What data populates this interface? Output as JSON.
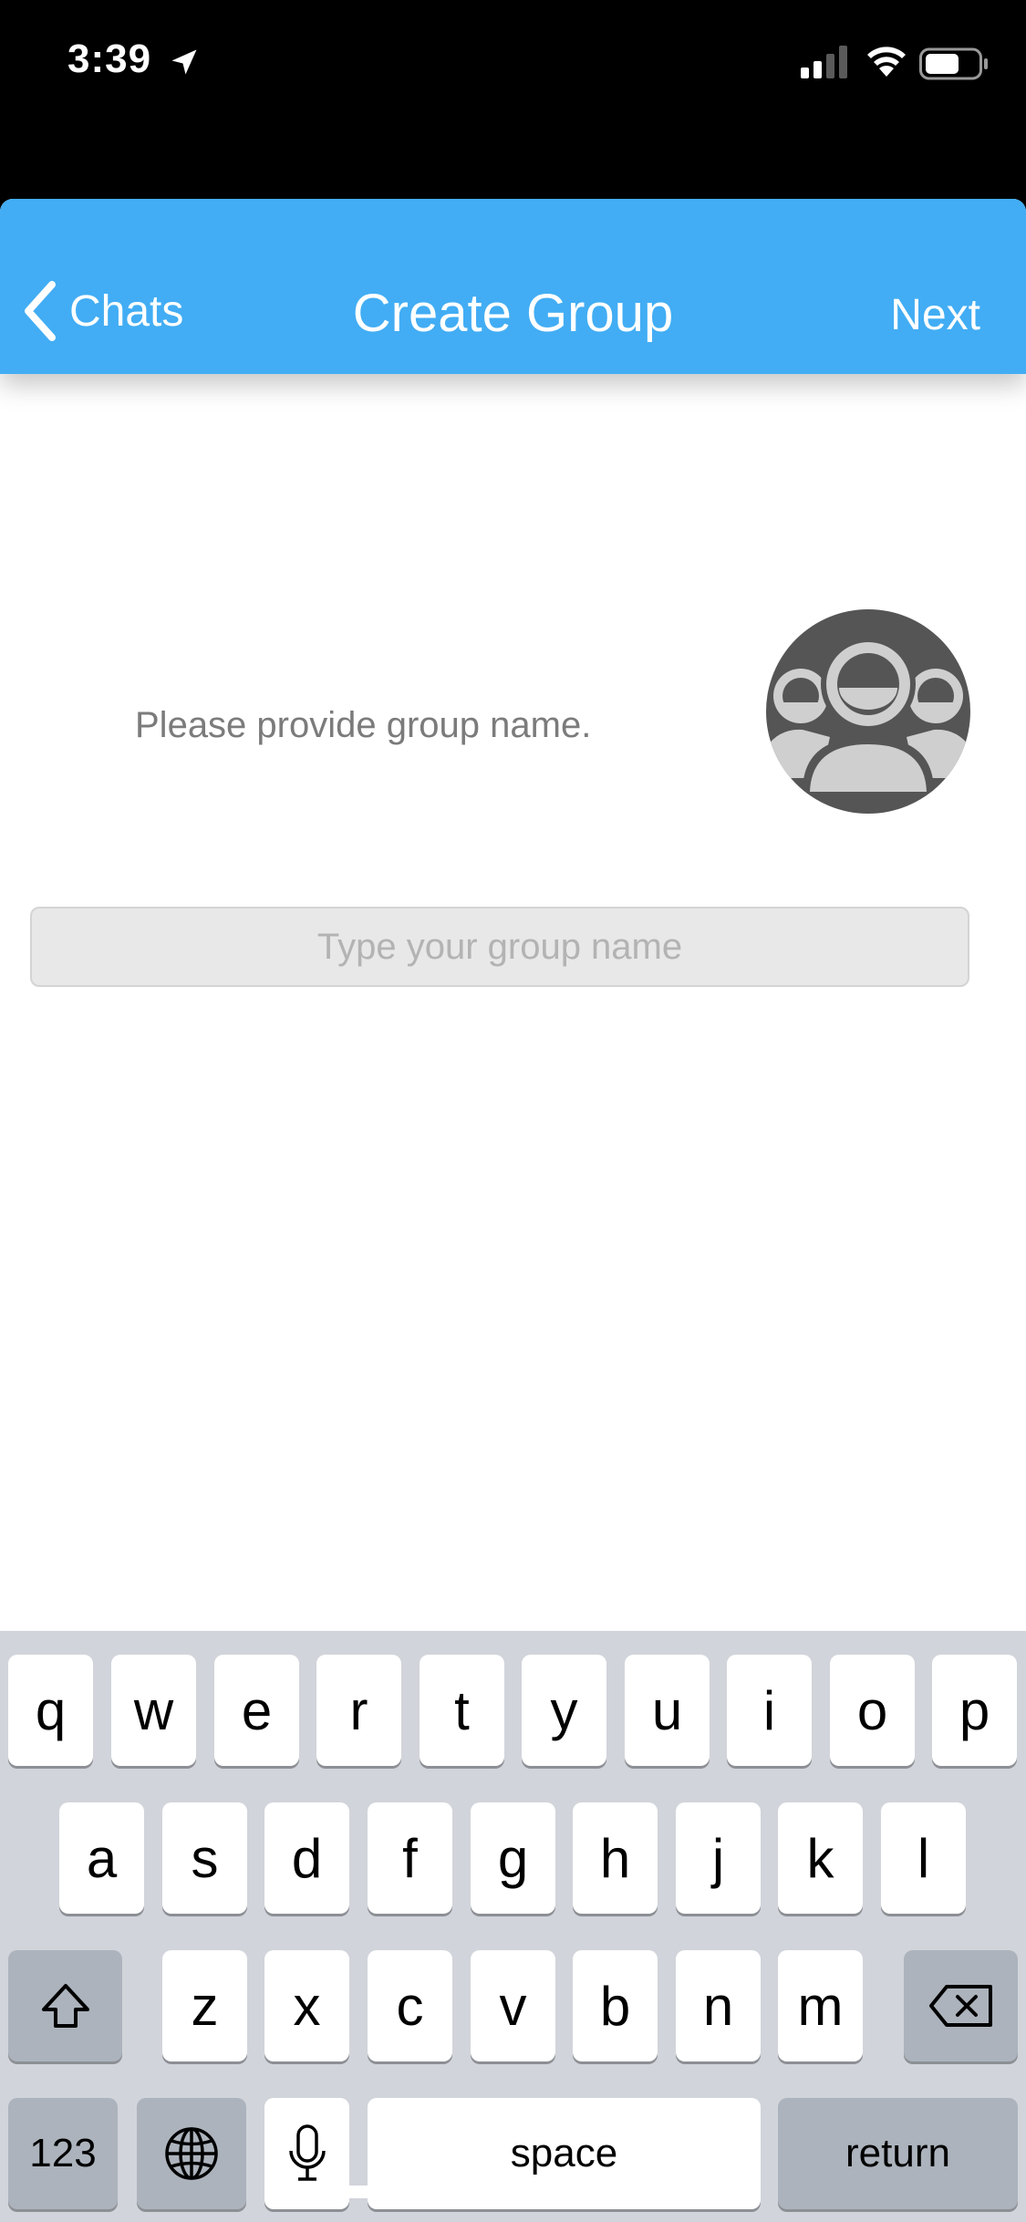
{
  "status_bar": {
    "time": "3:39",
    "location_icon": "location-arrow-icon",
    "signal_icon": "cellular-signal-icon",
    "wifi_icon": "wifi-icon",
    "battery_icon": "battery-icon"
  },
  "navbar": {
    "back_label": "Chats",
    "title": "Create Group",
    "next_label": "Next",
    "color": "#42adf4"
  },
  "content": {
    "prompt": "Please provide group name.",
    "avatar_icon": "group-people-icon",
    "input_value": "",
    "input_placeholder": "Type your group name"
  },
  "keyboard": {
    "row1": [
      "q",
      "w",
      "e",
      "r",
      "t",
      "y",
      "u",
      "i",
      "o",
      "p"
    ],
    "row2": [
      "a",
      "s",
      "d",
      "f",
      "g",
      "h",
      "j",
      "k",
      "l"
    ],
    "row3": [
      "z",
      "x",
      "c",
      "v",
      "b",
      "n",
      "m"
    ],
    "shift_icon": "shift-icon",
    "delete_icon": "backspace-icon",
    "numbers_label": "123",
    "globe_icon": "globe-icon",
    "mic_icon": "microphone-icon",
    "space_label": "space",
    "return_label": "return"
  }
}
